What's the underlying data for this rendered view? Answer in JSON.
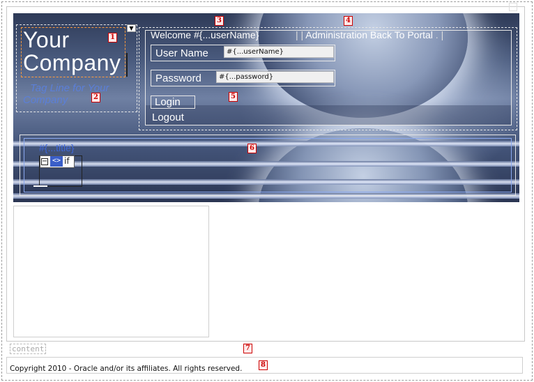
{
  "header": {
    "company_line1": "Your",
    "company_line2": "Company",
    "tagline_line1": "Tag Line for Your",
    "tagline_line2": "Company",
    "dropdown_arrow": "▼",
    "welcome": "Welcome #{...userName}",
    "separator": "|",
    "admin_link": "Administration",
    "back_link": "Back To Portal",
    "ellipsis": ". |"
  },
  "login": {
    "username_label": "User Name",
    "username_value": "#{...userName}",
    "password_label": "Password",
    "password_value": "#{...password}",
    "login_button": "Login",
    "logout_link": "Logout"
  },
  "title_region": {
    "title": "#{...title}",
    "if_label": "if",
    "code_glyph": "<>",
    "collapse_glyph": "−"
  },
  "badges": [
    "1",
    "2",
    "3",
    "4",
    "5",
    "6",
    "7",
    "8"
  ],
  "content_label": "content",
  "footer": {
    "copyright": "Copyright 2010 - Oracle and/or its affiliates. All rights reserved."
  },
  "colors": {
    "header_dark": "#2e3a57",
    "link_blue": "#3f67d8",
    "badge_red": "#cc0000",
    "selection_orange": "#ff9a3c"
  }
}
